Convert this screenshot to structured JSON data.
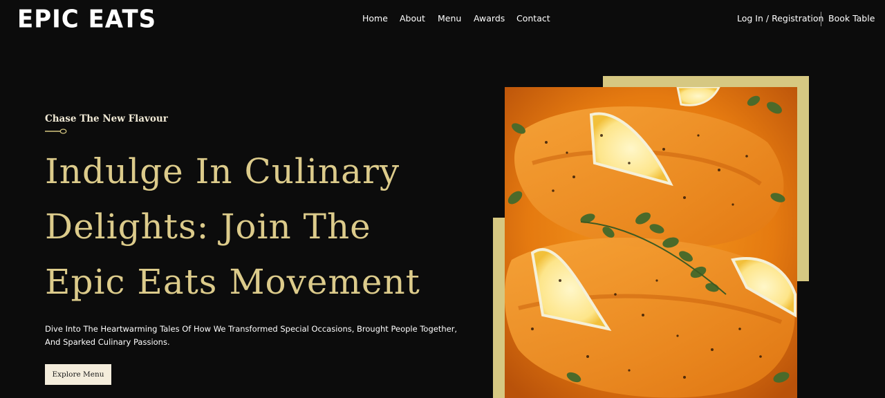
{
  "brand": {
    "logo_text": "EPIC EATS"
  },
  "nav": {
    "items": [
      {
        "label": "Home"
      },
      {
        "label": "About"
      },
      {
        "label": "Menu"
      },
      {
        "label": "Awards"
      },
      {
        "label": "Contact"
      }
    ],
    "login_label": "Log In / Registration",
    "book_label": "Book Table"
  },
  "hero": {
    "eyebrow": "Chase The New Flavour",
    "headline_lines": [
      "Indulge In Culinary",
      "Delights: Join The",
      "Epic Eats Movement"
    ],
    "description_lines": [
      "Dive Into The Heartwarming Tales Of How We Transformed Special Occasions, Brought People Together,",
      "And Sparked Culinary Passions."
    ],
    "cta_label": "Explore Menu"
  },
  "colors": {
    "background": "#0c0c0c",
    "headline_gold": "#dccb8b",
    "frame_gold": "#d6c882",
    "cta_background": "#f4eddc"
  },
  "icons": {
    "divider": "spoon-icon"
  }
}
